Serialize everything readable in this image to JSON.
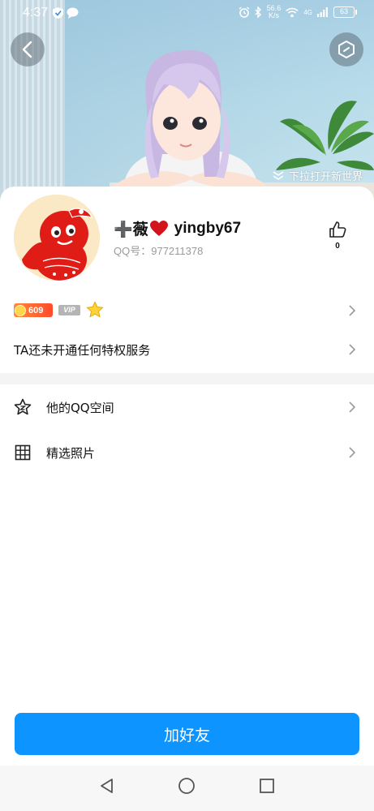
{
  "status_bar": {
    "time": "4:37",
    "net_speed_value": "56.6",
    "net_speed_unit": "K/s",
    "network_type": "4G",
    "battery": "63"
  },
  "hero": {
    "pull_hint": "下拉打开新世界"
  },
  "profile": {
    "nickname_prefix": "➕薇",
    "nickname_suffix": "yingby67",
    "qq_label": "QQ号：",
    "qq_number": "977211378",
    "like_count": "0"
  },
  "badges": {
    "level": "609",
    "vip_label": "VIP"
  },
  "privilege": {
    "text": "TA还未开通任何特权服务"
  },
  "menu": [
    {
      "label": "他的QQ空间",
      "icon": "star-icon"
    },
    {
      "label": "精选照片",
      "icon": "grid-icon"
    }
  ],
  "action": {
    "add_friend_label": "加好友"
  },
  "colors": {
    "primary": "#0d94ff",
    "level_badge": "#ff5a2b",
    "divider": "#f4f4f4",
    "secondary_text": "#9a9a9a"
  }
}
